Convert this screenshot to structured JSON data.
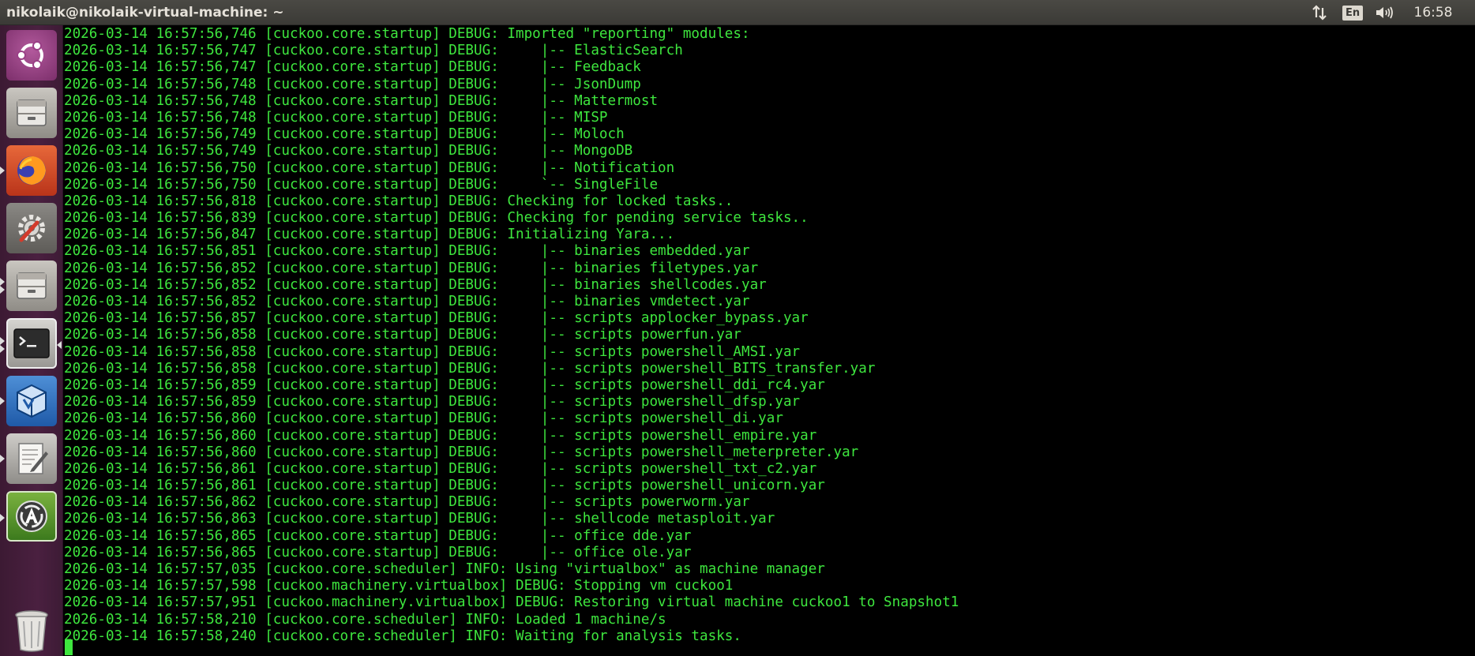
{
  "window": {
    "title": "nikolaik@nikolaik-virtual-machine: ~"
  },
  "panel": {
    "keyboard_layout": "En",
    "clock": "16:58"
  },
  "colors": {
    "terminal_text": "#3ee63e",
    "terminal_bg": "#000000",
    "launcher_bg": "#4a2040",
    "panel_bg": "#3b3a36"
  },
  "launcher": [
    {
      "name": "ubuntu-dash-icon"
    },
    {
      "name": "files-icon"
    },
    {
      "name": "firefox-icon"
    },
    {
      "name": "system-settings-icon"
    },
    {
      "name": "files-icon-2"
    },
    {
      "name": "terminal-icon"
    },
    {
      "name": "virtualbox-icon"
    },
    {
      "name": "text-editor-icon"
    },
    {
      "name": "software-updater-icon"
    },
    {
      "name": "trash-icon"
    }
  ],
  "terminal": {
    "lines": [
      "2026-03-14 16:57:56,746 [cuckoo.core.startup] DEBUG: Imported \"reporting\" modules:",
      "2026-03-14 16:57:56,747 [cuckoo.core.startup] DEBUG:     |-- ElasticSearch",
      "2026-03-14 16:57:56,747 [cuckoo.core.startup] DEBUG:     |-- Feedback",
      "2026-03-14 16:57:56,748 [cuckoo.core.startup] DEBUG:     |-- JsonDump",
      "2026-03-14 16:57:56,748 [cuckoo.core.startup] DEBUG:     |-- Mattermost",
      "2026-03-14 16:57:56,748 [cuckoo.core.startup] DEBUG:     |-- MISP",
      "2026-03-14 16:57:56,749 [cuckoo.core.startup] DEBUG:     |-- Moloch",
      "2026-03-14 16:57:56,749 [cuckoo.core.startup] DEBUG:     |-- MongoDB",
      "2026-03-14 16:57:56,750 [cuckoo.core.startup] DEBUG:     |-- Notification",
      "2026-03-14 16:57:56,750 [cuckoo.core.startup] DEBUG:     `-- SingleFile",
      "2026-03-14 16:57:56,818 [cuckoo.core.startup] DEBUG: Checking for locked tasks..",
      "2026-03-14 16:57:56,839 [cuckoo.core.startup] DEBUG: Checking for pending service tasks..",
      "2026-03-14 16:57:56,847 [cuckoo.core.startup] DEBUG: Initializing Yara...",
      "2026-03-14 16:57:56,851 [cuckoo.core.startup] DEBUG:     |-- binaries embedded.yar",
      "2026-03-14 16:57:56,852 [cuckoo.core.startup] DEBUG:     |-- binaries filetypes.yar",
      "2026-03-14 16:57:56,852 [cuckoo.core.startup] DEBUG:     |-- binaries shellcodes.yar",
      "2026-03-14 16:57:56,852 [cuckoo.core.startup] DEBUG:     |-- binaries vmdetect.yar",
      "2026-03-14 16:57:56,857 [cuckoo.core.startup] DEBUG:     |-- scripts applocker_bypass.yar",
      "2026-03-14 16:57:56,858 [cuckoo.core.startup] DEBUG:     |-- scripts powerfun.yar",
      "2026-03-14 16:57:56,858 [cuckoo.core.startup] DEBUG:     |-- scripts powershell_AMSI.yar",
      "2026-03-14 16:57:56,858 [cuckoo.core.startup] DEBUG:     |-- scripts powershell_BITS_transfer.yar",
      "2026-03-14 16:57:56,859 [cuckoo.core.startup] DEBUG:     |-- scripts powershell_ddi_rc4.yar",
      "2026-03-14 16:57:56,859 [cuckoo.core.startup] DEBUG:     |-- scripts powershell_dfsp.yar",
      "2026-03-14 16:57:56,860 [cuckoo.core.startup] DEBUG:     |-- scripts powershell_di.yar",
      "2026-03-14 16:57:56,860 [cuckoo.core.startup] DEBUG:     |-- scripts powershell_empire.yar",
      "2026-03-14 16:57:56,860 [cuckoo.core.startup] DEBUG:     |-- scripts powershell_meterpreter.yar",
      "2026-03-14 16:57:56,861 [cuckoo.core.startup] DEBUG:     |-- scripts powershell_txt_c2.yar",
      "2026-03-14 16:57:56,861 [cuckoo.core.startup] DEBUG:     |-- scripts powershell_unicorn.yar",
      "2026-03-14 16:57:56,862 [cuckoo.core.startup] DEBUG:     |-- scripts powerworm.yar",
      "2026-03-14 16:57:56,863 [cuckoo.core.startup] DEBUG:     |-- shellcode metasploit.yar",
      "2026-03-14 16:57:56,865 [cuckoo.core.startup] DEBUG:     |-- office dde.yar",
      "2026-03-14 16:57:56,865 [cuckoo.core.startup] DEBUG:     |-- office ole.yar",
      "2026-03-14 16:57:57,035 [cuckoo.core.scheduler] INFO: Using \"virtualbox\" as machine manager",
      "2026-03-14 16:57:57,598 [cuckoo.machinery.virtualbox] DEBUG: Stopping vm cuckoo1",
      "2026-03-14 16:57:57,951 [cuckoo.machinery.virtualbox] DEBUG: Restoring virtual machine cuckoo1 to Snapshot1",
      "2026-03-14 16:57:58,210 [cuckoo.core.scheduler] INFO: Loaded 1 machine/s",
      "2026-03-14 16:57:58,240 [cuckoo.core.scheduler] INFO: Waiting for analysis tasks."
    ]
  }
}
